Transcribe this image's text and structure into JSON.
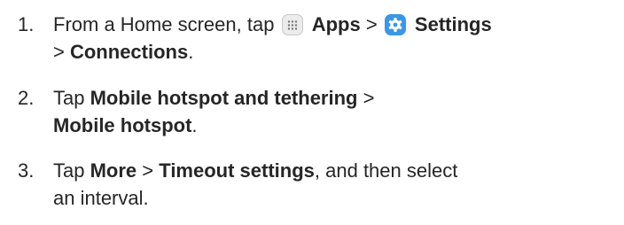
{
  "steps": [
    {
      "number": "1.",
      "line1": {
        "t1": "From a Home screen, tap",
        "apps_icon": "apps-grid-icon",
        "apps": "Apps",
        "sep1": ">",
        "settings_icon": "settings-gear-icon",
        "settings": "Settings"
      },
      "line2": {
        "sep": ">",
        "connections": "Connections",
        "end": "."
      }
    },
    {
      "number": "2.",
      "line1": {
        "t1": "Tap",
        "bold": "Mobile hotspot and tethering",
        "sep": ">"
      },
      "line2": {
        "bold": "Mobile hotspot",
        "end": "."
      }
    },
    {
      "number": "3.",
      "line1": {
        "t1": "Tap",
        "more": "More",
        "sep": ">",
        "timeout": "Timeout settings",
        "rest": ", and then select"
      },
      "line2": {
        "text": "an interval."
      }
    }
  ],
  "colors": {
    "text": "#262626",
    "settings_icon_bg": "#3b97e3",
    "apps_icon_bg": "#ececec"
  }
}
